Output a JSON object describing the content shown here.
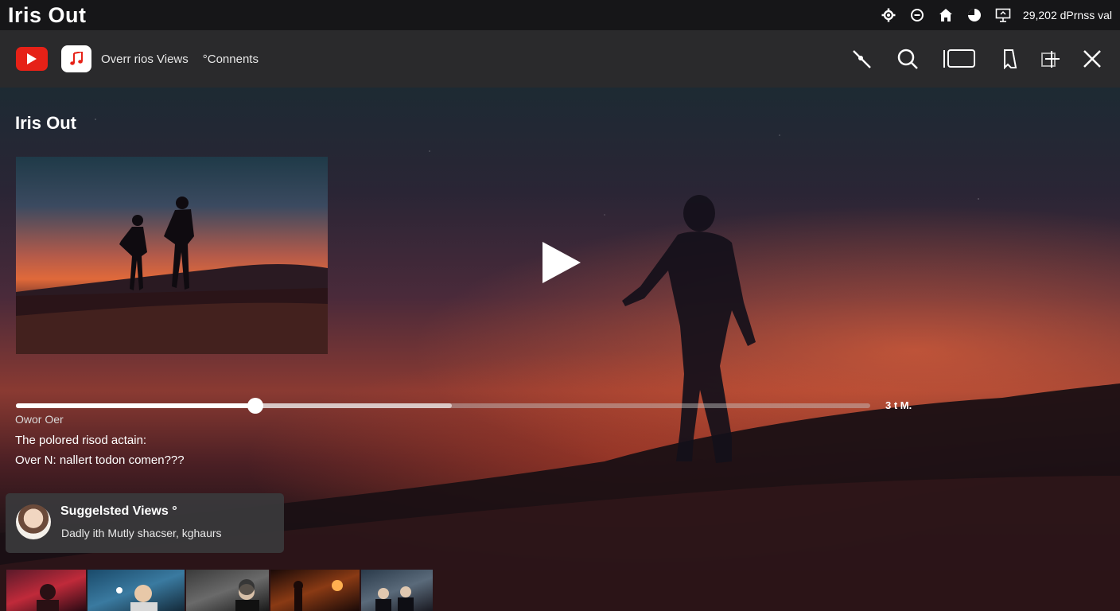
{
  "status_bar": {
    "app_title": "Iris  Out",
    "right_text": "29,202 dPrnss val",
    "icons": [
      "settings-gear-icon",
      "minus-circle-icon",
      "home-icon",
      "pie-clock-icon",
      "screen-share-icon"
    ]
  },
  "tab_bar": {
    "tab_1_label": "Overr rios Views",
    "tab_2_label": "°Connents",
    "toolbar_icons": [
      "magic-wand-icon",
      "search-icon",
      "window-icon",
      "bookmark-icon",
      "crop-add-icon",
      "close-icon"
    ]
  },
  "player": {
    "title": "Iris Out",
    "time_label": "3 t M.",
    "progress_played": 0.28,
    "progress_buffered": 0.51
  },
  "info": {
    "line_1": "Owor Oer",
    "line_2": "The polored risod actain:",
    "line_3": "Over  N: nallert todon comen???"
  },
  "suggested": {
    "title": "Suggelsted Views °",
    "subtitle": "Dadly ith Mutly shacser, kghaurs"
  },
  "colors": {
    "youtube_red": "#e62117",
    "tabbar_bg": "#2a2a2c",
    "statusbar_bg": "#161618"
  }
}
